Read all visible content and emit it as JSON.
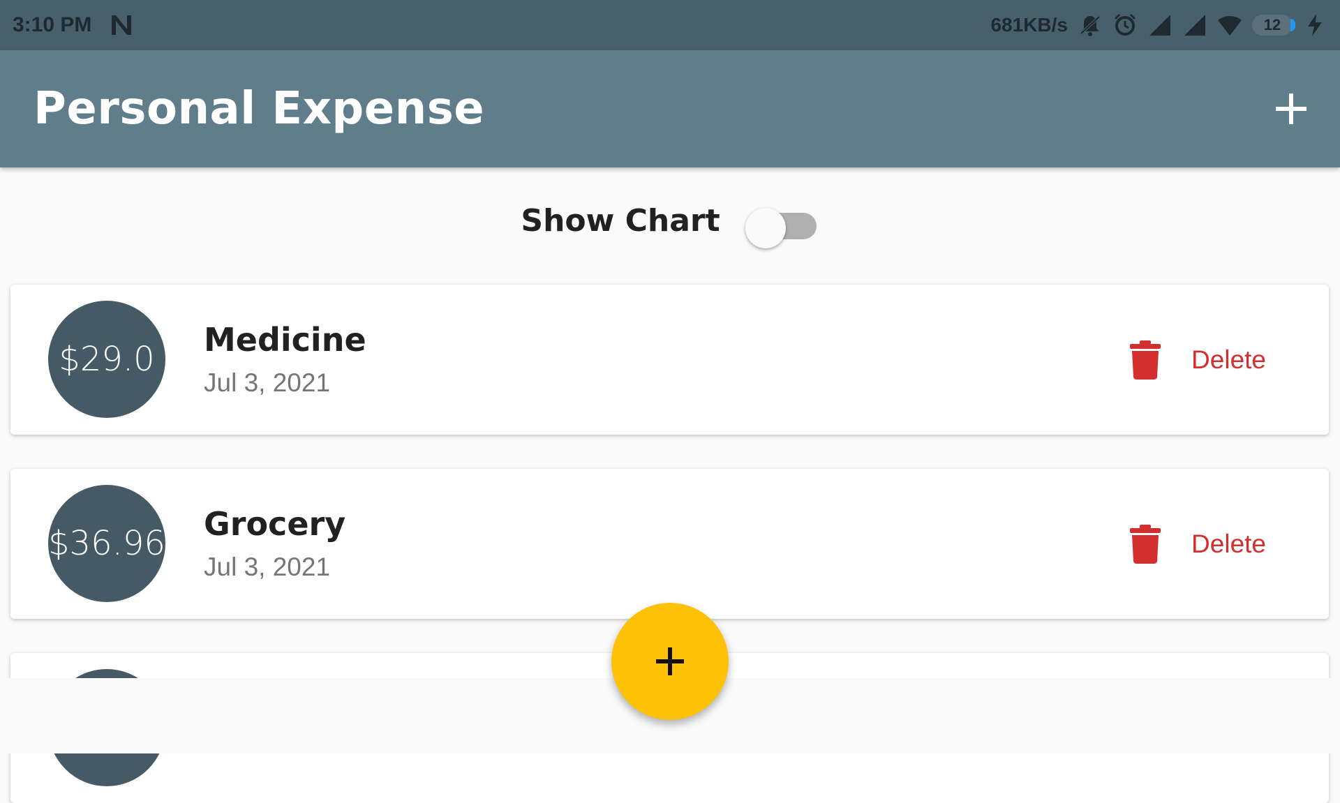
{
  "status_bar": {
    "time": "3:10 PM",
    "network_speed": "681KB/s",
    "battery_level": "12"
  },
  "app_bar": {
    "title": "Personal Expense",
    "add_icon": "plus-icon"
  },
  "chart_toggle": {
    "label": "Show Chart",
    "enabled": false
  },
  "transactions": [
    {
      "amount": "$29.0",
      "title": "Medicine",
      "date": "Jul 3, 2021",
      "delete_label": "Delete"
    },
    {
      "amount": "$36.96",
      "title": "Grocery",
      "date": "Jul 3, 2021",
      "delete_label": "Delete"
    }
  ],
  "fab": {
    "icon": "plus-icon"
  },
  "colors": {
    "primary": "#607d8b",
    "primary_dark": "#455a64",
    "accent": "#fec106",
    "delete": "#d32f2f"
  }
}
